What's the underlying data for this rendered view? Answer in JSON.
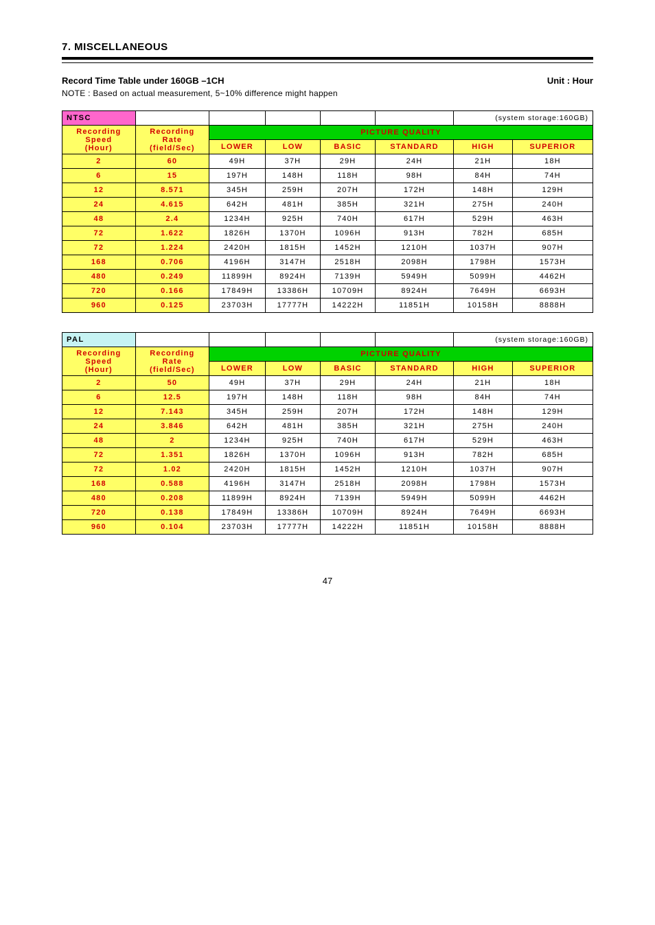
{
  "doc": {
    "section_title": "7. MISCELLANEOUS",
    "subtitle_bold": "Record Time Table under 160GB –1CH",
    "subtitle_unit": "Unit : Hour",
    "note": "NOTE : Based on actual measurement, 5~10% difference might happen"
  },
  "table1": {
    "format_label": "NTSC",
    "storage_label": "(system storage:160GB)",
    "col1_label_l1": "Recording",
    "col1_label_l2": "Speed",
    "col1_label_l3": "(Hour)",
    "col2_label_l1": "Recording",
    "col2_label_l2": "Rate",
    "col2_label_l3": "(field/Sec)",
    "pq_label": "PICTURE QUALITY",
    "q_labels": [
      "LOWER",
      "LOW",
      "BASIC",
      "STANDARD",
      "HIGH",
      "SUPERIOR"
    ],
    "rows": [
      {
        "speed": "2",
        "rate": "60",
        "v": [
          "49H",
          "37H",
          "29H",
          "24H",
          "21H",
          "18H"
        ]
      },
      {
        "speed": "6",
        "rate": "15",
        "v": [
          "197H",
          "148H",
          "118H",
          "98H",
          "84H",
          "74H"
        ]
      },
      {
        "speed": "12",
        "rate": "8.571",
        "v": [
          "345H",
          "259H",
          "207H",
          "172H",
          "148H",
          "129H"
        ]
      },
      {
        "speed": "24",
        "rate": "4.615",
        "v": [
          "642H",
          "481H",
          "385H",
          "321H",
          "275H",
          "240H"
        ]
      },
      {
        "speed": "48",
        "rate": "2.4",
        "v": [
          "1234H",
          "925H",
          "740H",
          "617H",
          "529H",
          "463H"
        ]
      },
      {
        "speed": "72",
        "rate": "1.622",
        "v": [
          "1826H",
          "1370H",
          "1096H",
          "913H",
          "782H",
          "685H"
        ]
      },
      {
        "speed": "72",
        "rate": "1.224",
        "v": [
          "2420H",
          "1815H",
          "1452H",
          "1210H",
          "1037H",
          "907H"
        ]
      },
      {
        "speed": "168",
        "rate": "0.706",
        "v": [
          "4196H",
          "3147H",
          "2518H",
          "2098H",
          "1798H",
          "1573H"
        ]
      },
      {
        "speed": "480",
        "rate": "0.249",
        "v": [
          "11899H",
          "8924H",
          "7139H",
          "5949H",
          "5099H",
          "4462H"
        ]
      },
      {
        "speed": "720",
        "rate": "0.166",
        "v": [
          "17849H",
          "13386H",
          "10709H",
          "8924H",
          "7649H",
          "6693H"
        ]
      },
      {
        "speed": "960",
        "rate": "0.125",
        "v": [
          "23703H",
          "17777H",
          "14222H",
          "11851H",
          "10158H",
          "8888H"
        ]
      }
    ]
  },
  "table2": {
    "format_label": "PAL",
    "storage_label": "(system storage:160GB)",
    "col1_label_l1": "Recording",
    "col1_label_l2": "Speed",
    "col1_label_l3": "(Hour)",
    "col2_label_l1": "Recording",
    "col2_label_l2": "Rate",
    "col2_label_l3": "(field/Sec)",
    "pq_label": "PICTURE QUALITY",
    "q_labels": [
      "LOWER",
      "LOW",
      "BASIC",
      "STANDARD",
      "HIGH",
      "SUPERIOR"
    ],
    "rows": [
      {
        "speed": "2",
        "rate": "50",
        "v": [
          "49H",
          "37H",
          "29H",
          "24H",
          "21H",
          "18H"
        ]
      },
      {
        "speed": "6",
        "rate": "12.5",
        "v": [
          "197H",
          "148H",
          "118H",
          "98H",
          "84H",
          "74H"
        ]
      },
      {
        "speed": "12",
        "rate": "7.143",
        "v": [
          "345H",
          "259H",
          "207H",
          "172H",
          "148H",
          "129H"
        ]
      },
      {
        "speed": "24",
        "rate": "3.846",
        "v": [
          "642H",
          "481H",
          "385H",
          "321H",
          "275H",
          "240H"
        ]
      },
      {
        "speed": "48",
        "rate": "2",
        "v": [
          "1234H",
          "925H",
          "740H",
          "617H",
          "529H",
          "463H"
        ]
      },
      {
        "speed": "72",
        "rate": "1.351",
        "v": [
          "1826H",
          "1370H",
          "1096H",
          "913H",
          "782H",
          "685H"
        ]
      },
      {
        "speed": "72",
        "rate": "1.02",
        "v": [
          "2420H",
          "1815H",
          "1452H",
          "1210H",
          "1037H",
          "907H"
        ]
      },
      {
        "speed": "168",
        "rate": "0.588",
        "v": [
          "4196H",
          "3147H",
          "2518H",
          "2098H",
          "1798H",
          "1573H"
        ]
      },
      {
        "speed": "480",
        "rate": "0.208",
        "v": [
          "11899H",
          "8924H",
          "7139H",
          "5949H",
          "5099H",
          "4462H"
        ]
      },
      {
        "speed": "720",
        "rate": "0.138",
        "v": [
          "17849H",
          "13386H",
          "10709H",
          "8924H",
          "7649H",
          "6693H"
        ]
      },
      {
        "speed": "960",
        "rate": "0.104",
        "v": [
          "23703H",
          "17777H",
          "14222H",
          "11851H",
          "10158H",
          "8888H"
        ]
      }
    ]
  },
  "footer": {
    "page": "47"
  }
}
